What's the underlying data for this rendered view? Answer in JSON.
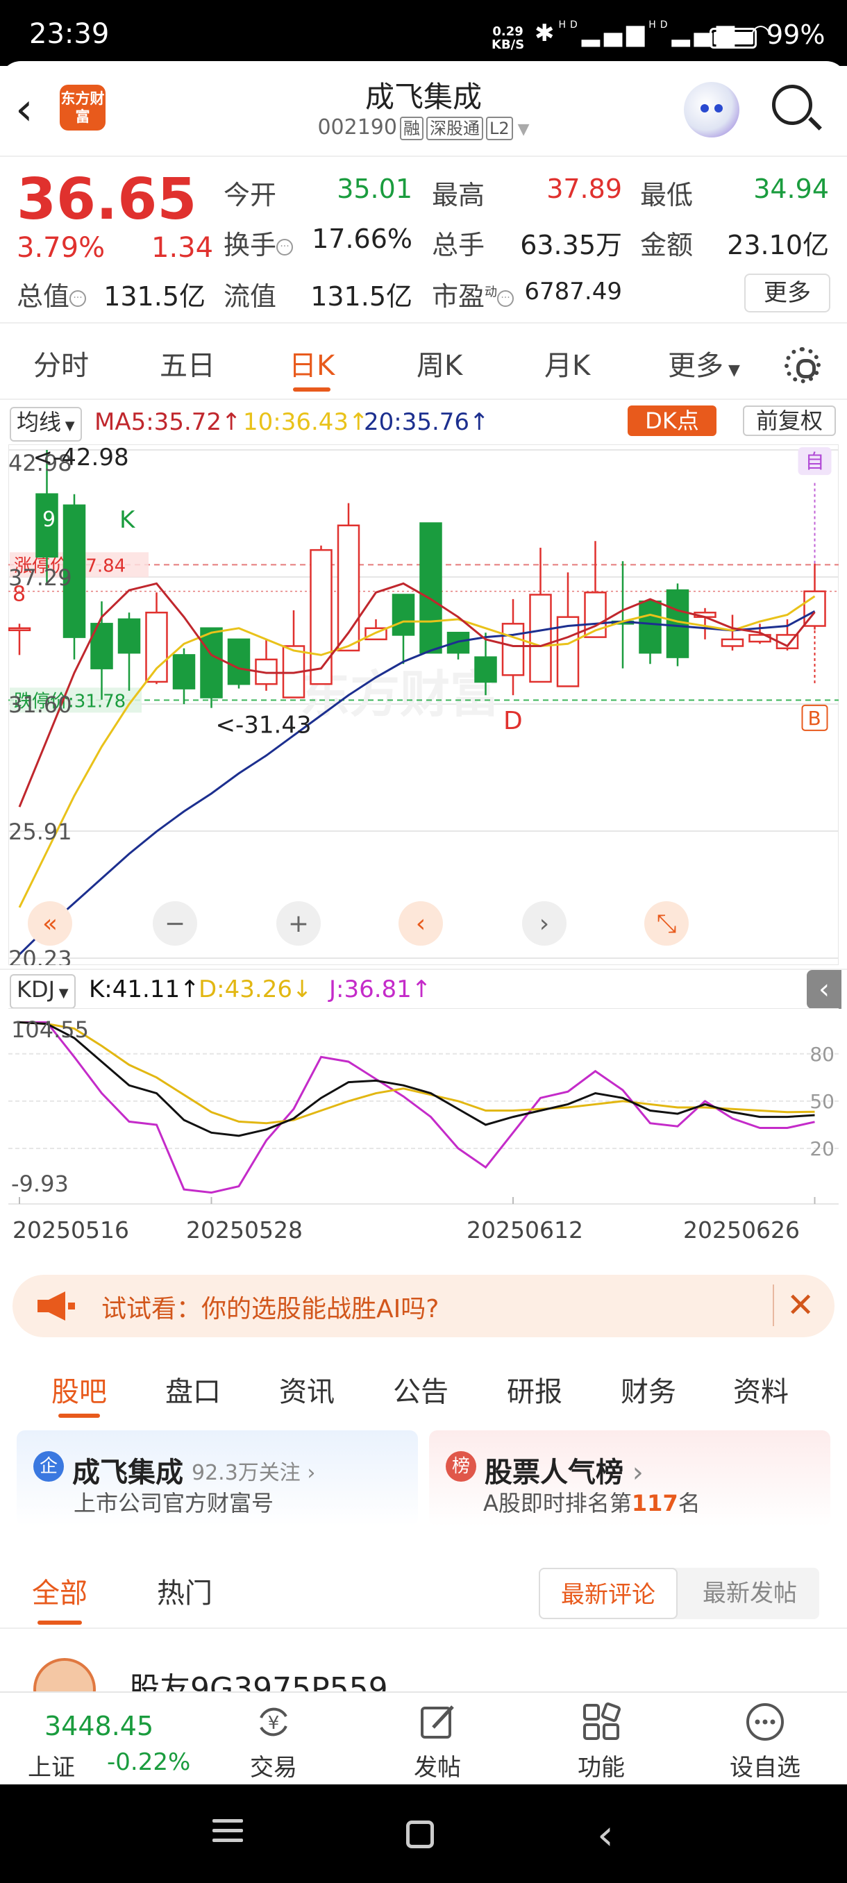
{
  "status_bar": {
    "time": "23:39",
    "net_speed": "0.29",
    "net_unit": "KB/S",
    "signal": "HD",
    "battery": "99%"
  },
  "header": {
    "title": "成飞集成",
    "code": "002190",
    "tags": [
      "融",
      "深股通",
      "L2"
    ],
    "logo_text": "东方财富"
  },
  "quote": {
    "price": "36.65",
    "change_pct": "3.79%",
    "change": "1.34",
    "rows": [
      [
        {
          "label": "今开",
          "value": "35.01",
          "color": "green"
        },
        {
          "label": "最高",
          "value": "37.89",
          "color": "red"
        },
        {
          "label": "最低",
          "value": "34.94",
          "color": "green"
        }
      ],
      [
        {
          "label": "换手",
          "value": "17.66%",
          "color": "black"
        },
        {
          "label": "总手",
          "value": "63.35万",
          "color": "black"
        },
        {
          "label": "金额",
          "value": "23.10亿",
          "color": "black"
        }
      ]
    ],
    "row3": {
      "total_mv_label": "总值",
      "total_mv": "131.5亿",
      "float_mv_label": "流值",
      "float_mv": "131.5亿",
      "pe_label": "市盈",
      "pe_sup": "动",
      "pe": "6787.49"
    },
    "more": "更多"
  },
  "period_tabs": [
    "分时",
    "五日",
    "日K",
    "周K",
    "月K",
    "更多"
  ],
  "active_period": "日K",
  "ma_bar": {
    "selector": "均线",
    "ma5": "MA5:35.72",
    "ma10": "10:36.43",
    "ma20": "20:35.76",
    "dk": "DK点",
    "adjust": "前复权"
  },
  "colors": {
    "accent": "#e85a1c",
    "up": "#e0312e",
    "down": "#1a9c3e",
    "ma5": "#c0272d",
    "ma10": "#e9c21a",
    "ma20": "#1c2f8f",
    "k": "#111111",
    "d": "#e2b712",
    "j": "#c42bc9"
  },
  "kchart_labels": {
    "y_ticks": [
      "42.98",
      "37.29",
      "31.60",
      "25.91",
      "20.23"
    ],
    "limit_up": "涨停价:37.84",
    "limit_down": "跌停价:31.78",
    "high_mark": "<-42.98",
    "low_mark": "<-31.43",
    "sig_9": "9",
    "sig_k": "K",
    "sig_8": "8",
    "sig_d": "D",
    "sig_b": "B",
    "sig_zi": "自",
    "watermark": "东方财富",
    "controls": [
      "«",
      "−",
      "+",
      "‹",
      "›",
      "⤡"
    ]
  },
  "kdj_bar": {
    "selector": "KDJ",
    "k": "K:41.11",
    "d": "D:43.26",
    "j": "J:36.81",
    "collapse": "‹"
  },
  "kdj_labels": {
    "y_left": [
      "104.55",
      "-9.93"
    ],
    "y_right": [
      "80",
      "50",
      "20"
    ]
  },
  "dates": [
    "20250516",
    "20250528",
    "20250612",
    "20250626"
  ],
  "chart_data": {
    "type": "candlestick",
    "x": [
      "20250516",
      "20250519",
      "20250520",
      "20250521",
      "20250522",
      "20250523",
      "20250526",
      "20250527",
      "20250528",
      "20250529",
      "20250530",
      "20250603",
      "20250604",
      "20250605",
      "20250606",
      "20250609",
      "20250610",
      "20250611",
      "20250612",
      "20250613",
      "20250616",
      "20250617",
      "20250618",
      "20250619",
      "20250620",
      "20250623",
      "20250624",
      "20250625",
      "20250626",
      "20250627"
    ],
    "ylim": [
      20.23,
      42.98
    ],
    "open": [
      35.0,
      41.0,
      40.5,
      35.2,
      35.4,
      32.6,
      33.8,
      35.0,
      34.5,
      32.5,
      31.9,
      32.5,
      34.0,
      34.5,
      36.5,
      39.7,
      34.8,
      33.7,
      32.9,
      32.6,
      32.4,
      34.6,
      35.3,
      36.2,
      36.7,
      35.5,
      34.2,
      34.4,
      34.1,
      35.1
    ],
    "close": [
      35.0,
      38.2,
      34.6,
      33.2,
      33.9,
      35.7,
      32.3,
      31.9,
      32.5,
      33.6,
      34.2,
      38.5,
      39.6,
      35.0,
      34.7,
      33.9,
      33.9,
      32.6,
      35.2,
      36.5,
      35.5,
      36.6,
      35.2,
      33.9,
      33.7,
      35.7,
      34.5,
      34.7,
      34.7,
      36.65
    ],
    "high": [
      35.2,
      42.98,
      41.0,
      36.2,
      35.7,
      36.6,
      34.1,
      32.2,
      33.8,
      34.5,
      35.8,
      38.7,
      40.6,
      35.4,
      35.0,
      35.4,
      34.0,
      34.8,
      36.3,
      38.6,
      37.5,
      38.9,
      38.0,
      36.3,
      37.0,
      35.9,
      35.6,
      35.2,
      35.4,
      37.89
    ],
    "low": [
      33.8,
      37.0,
      33.6,
      31.8,
      32.2,
      32.5,
      31.6,
      31.43,
      32.3,
      32.2,
      33.8,
      33.5,
      36.2,
      34.8,
      33.4,
      34.0,
      33.6,
      32.0,
      32.0,
      34.7,
      35.0,
      35.5,
      33.2,
      33.4,
      33.3,
      34.5,
      34.0,
      34.3,
      34.0,
      34.94
    ],
    "ma5": [
      27.0,
      30.0,
      33.0,
      35.5,
      36.7,
      37.0,
      35.5,
      33.8,
      33.2,
      33.0,
      33.0,
      33.2,
      34.8,
      36.6,
      37.0,
      36.3,
      35.5,
      34.5,
      34.2,
      34.2,
      34.6,
      35.1,
      35.8,
      36.3,
      35.8,
      35.5,
      35.0,
      34.8,
      34.2,
      35.72
    ],
    "ma10": [
      22.5,
      25.0,
      27.5,
      29.7,
      31.6,
      33.2,
      34.3,
      34.8,
      35.0,
      34.5,
      34.0,
      33.8,
      34.2,
      34.8,
      35.3,
      35.3,
      35.4,
      35.0,
      34.6,
      34.2,
      34.3,
      34.9,
      35.3,
      35.6,
      35.3,
      35.1,
      34.9,
      35.3,
      35.6,
      36.43
    ],
    "ma20": [
      20.4,
      21.6,
      22.7,
      23.8,
      24.9,
      25.9,
      26.8,
      27.6,
      28.5,
      29.3,
      30.2,
      31.1,
      32.0,
      32.8,
      33.5,
      34.0,
      34.4,
      34.6,
      34.7,
      34.9,
      35.1,
      35.2,
      35.3,
      35.2,
      35.1,
      35.0,
      34.9,
      35.0,
      35.1,
      35.76
    ],
    "kdj": {
      "ylim": [
        -9.93,
        104.55
      ],
      "k": [
        100,
        99,
        90,
        75,
        60,
        55,
        38,
        30,
        28,
        32,
        39,
        52,
        62,
        63,
        60,
        55,
        45,
        35,
        40,
        44,
        48,
        55,
        52,
        44,
        42,
        48,
        43,
        40,
        40,
        41.11
      ],
      "d": [
        100,
        99,
        96,
        85,
        73,
        65,
        54,
        43,
        37,
        36,
        38,
        44,
        50,
        55,
        58,
        54,
        50,
        44,
        44,
        45,
        46,
        48,
        50,
        48,
        46,
        46,
        45,
        44,
        43,
        43.26
      ],
      "j": [
        100,
        100,
        78,
        55,
        37,
        35,
        -6,
        -8,
        -4,
        25,
        45,
        78,
        75,
        64,
        53,
        40,
        20,
        8,
        30,
        52,
        56,
        69,
        57,
        36,
        34,
        50,
        39,
        33,
        33,
        36.81
      ]
    }
  },
  "ad": {
    "text": "试试看：你的选股能战胜AI吗?"
  },
  "section_tabs": [
    "股吧",
    "盘口",
    "资讯",
    "公告",
    "研报",
    "财务",
    "资料"
  ],
  "active_section": "股吧",
  "cards": [
    {
      "icon": "企",
      "title": "成飞集成",
      "meta": "92.3万关注",
      "sub": "上市公司官方财富号"
    },
    {
      "icon": "榜",
      "title": "股票人气榜",
      "sub_pre": "A股即时排名第",
      "rank": "117",
      "sub_post": "名"
    }
  ],
  "comment_tabs": [
    "全部",
    "热门"
  ],
  "sort": [
    "最新评论",
    "最新发帖"
  ],
  "post": {
    "username": "股友9G3975P559"
  },
  "bottom_nav": {
    "index_value": "3448.45",
    "index_name": "上证",
    "index_change": "-0.22%",
    "items": [
      "交易",
      "发帖",
      "功能",
      "设自选"
    ]
  }
}
